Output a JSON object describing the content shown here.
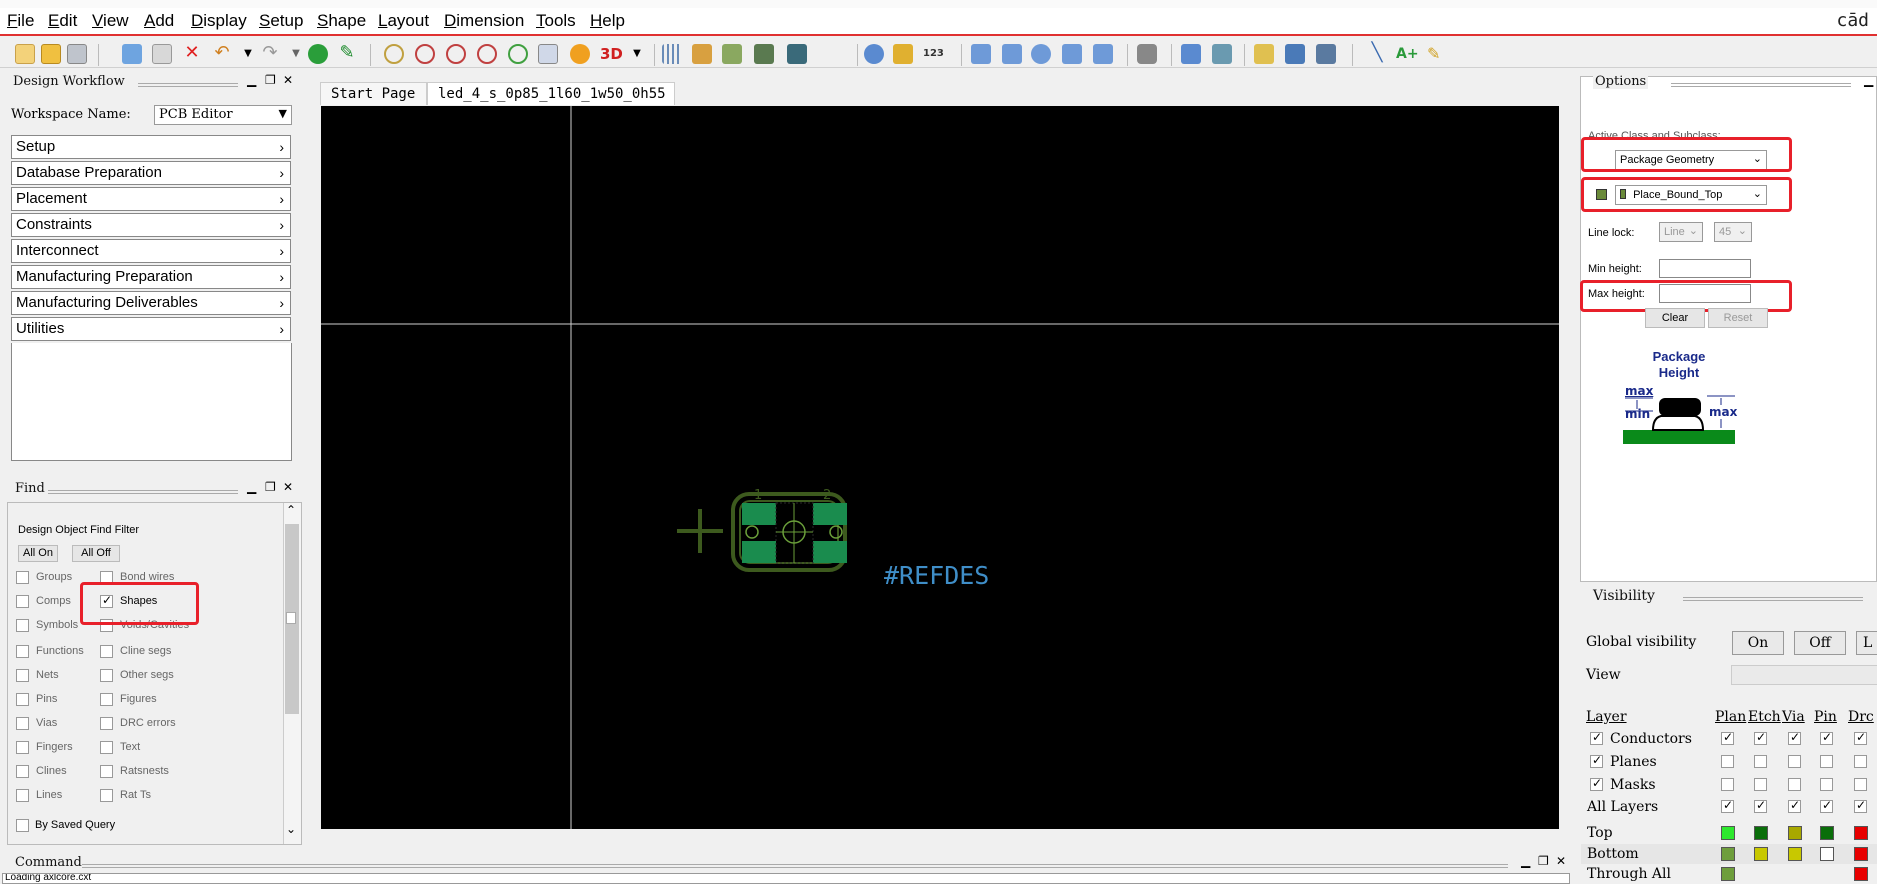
{
  "menu": [
    "File",
    "Edit",
    "View",
    "Add",
    "Display",
    "Setup",
    "Shape",
    "Layout",
    "Dimension",
    "Tools",
    "Help"
  ],
  "brand": "cād",
  "workflow": {
    "title": "Design Workflow",
    "workspace_label": "Workspace Name:",
    "workspace_value": "PCB Editor",
    "items": [
      "Setup",
      "Database Preparation",
      "Placement",
      "Constraints",
      "Interconnect",
      "Manufacturing Preparation",
      "Manufacturing Deliverables",
      "Utilities"
    ]
  },
  "find": {
    "title": "Find",
    "filter_title": "Design Object Find Filter",
    "all_on": "All On",
    "all_off": "All Off",
    "left": [
      "Groups",
      "Comps",
      "Symbols",
      "Functions",
      "Nets",
      "Pins",
      "Vias",
      "Fingers",
      "Clines",
      "Lines"
    ],
    "right": [
      "Bond wires",
      "Shapes",
      "Voids/Cavities",
      "Cline segs",
      "Other segs",
      "Figures",
      "DRC errors",
      "Text",
      "Ratsnests",
      "Rat Ts"
    ],
    "by_saved_query": "By Saved Query"
  },
  "tabs": [
    "Start Page",
    "led_4_s_0p85_1l60_1w50_0h55"
  ],
  "canvas": {
    "refdes": "#REFDES",
    "pin1": "1",
    "pin2": "2",
    "colors": {
      "pad": "#1a8c4e",
      "outline": "#3d5a1e",
      "refdes": "#3f8ec8",
      "cross": "#3d5a1e"
    }
  },
  "options": {
    "title": "Options",
    "active_class_label": "Active Class and Subclass:",
    "class_value": "Package Geometry",
    "subclass_value": "Place_Bound_Top",
    "line_lock_label": "Line lock:",
    "line_lock_value": "Line",
    "line_lock_angle": "45",
    "min_height_label": "Min height:",
    "max_height_label": "Max height:",
    "clear": "Clear",
    "reset": "Reset",
    "diagram": {
      "title1": "Package",
      "title2": "Height",
      "max": "max",
      "min": "min",
      "max_right": "max"
    }
  },
  "visibility": {
    "title": "Visibility",
    "global_label": "Global visibility",
    "on": "On",
    "off": "Off",
    "last": "L",
    "view_label": "View",
    "layer_header": "Layer",
    "columns": [
      "Plan",
      "Etch",
      "Via",
      "Pin",
      "Drc"
    ],
    "rows": [
      {
        "name": "Conductors",
        "master": true,
        "cells": [
          true,
          true,
          true,
          true,
          true
        ]
      },
      {
        "name": "Planes",
        "master": true,
        "cells": [
          false,
          false,
          false,
          false,
          false
        ]
      },
      {
        "name": "Masks",
        "master": true,
        "cells": [
          false,
          false,
          false,
          false,
          false
        ]
      },
      {
        "name": "All Layers",
        "master": false,
        "cells": [
          true,
          true,
          true,
          true,
          true
        ]
      }
    ],
    "layers": [
      {
        "name": "Top",
        "colors": [
          "#2ee82e",
          "#0a6e0a",
          "#a8a800",
          "#0a6e0a",
          "#e80000"
        ]
      },
      {
        "name": "Bottom",
        "colors": [
          "#6e9e3c",
          "#c8c800",
          "#c8c800",
          "#ffffff",
          "#e80000"
        ]
      },
      {
        "name": "Through All",
        "colors": [
          "#6e9e3c",
          "",
          "",
          "",
          "#e80000"
        ]
      }
    ]
  },
  "command": {
    "title": "Command",
    "log": "Loading axlcore.cxt"
  }
}
